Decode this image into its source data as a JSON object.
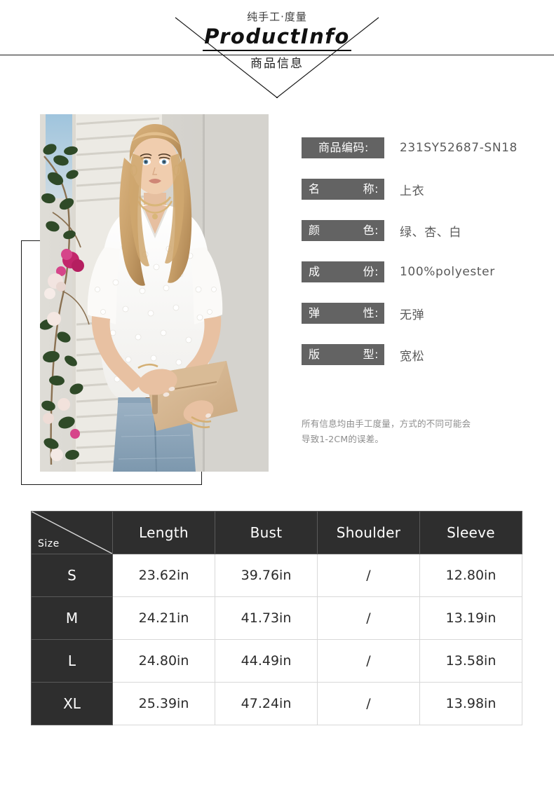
{
  "header": {
    "sub_top": "纯手工·度量",
    "title": "ProductInfo",
    "sub_bottom": "商品信息"
  },
  "photo": {
    "alt": "model-wearing-white-swiss-dot-v-neck-blouse"
  },
  "specs": [
    {
      "label": "商品编码:",
      "label_left": "商品编码:",
      "label_right": "",
      "value": "231SY52687-SN18",
      "spaced": false
    },
    {
      "label": "名　　称:",
      "label_left": "名",
      "label_right": "称:",
      "value": "上衣",
      "spaced": true
    },
    {
      "label": "颜　　色:",
      "label_left": "颜",
      "label_right": "色:",
      "value": "绿、杏、白",
      "spaced": true
    },
    {
      "label": "成　　份:",
      "label_left": "成",
      "label_right": "份:",
      "value": "100%polyester",
      "spaced": true
    },
    {
      "label": "弹　　性:",
      "label_left": "弹",
      "label_right": "性:",
      "value": "无弹",
      "spaced": true
    },
    {
      "label": "版　　型:",
      "label_left": "版",
      "label_right": "型:",
      "value": "宽松",
      "spaced": true
    }
  ],
  "note": {
    "line1": "所有信息均由手工度量，方式的不同可能会",
    "line2": "导致1-2CM的误差。"
  },
  "size_table": {
    "corner_label": "Size",
    "columns": [
      "Length",
      "Bust",
      "Shoulder",
      "Sleeve"
    ],
    "rows": [
      {
        "size": "S",
        "values": [
          "23.62in",
          "39.76in",
          "/",
          "12.80in"
        ]
      },
      {
        "size": "M",
        "values": [
          "24.21in",
          "41.73in",
          "/",
          "13.19in"
        ]
      },
      {
        "size": "L",
        "values": [
          "24.80in",
          "44.49in",
          "/",
          "13.58in"
        ]
      },
      {
        "size": "XL",
        "values": [
          "25.39in",
          "47.24in",
          "/",
          "13.98in"
        ]
      }
    ]
  },
  "colors": {
    "label_chip": "#636363",
    "table_header": "#2e2e2e",
    "rule": "#1a1a1a",
    "value_text": "#5a5a5a",
    "note_text": "#8d8d8d"
  }
}
